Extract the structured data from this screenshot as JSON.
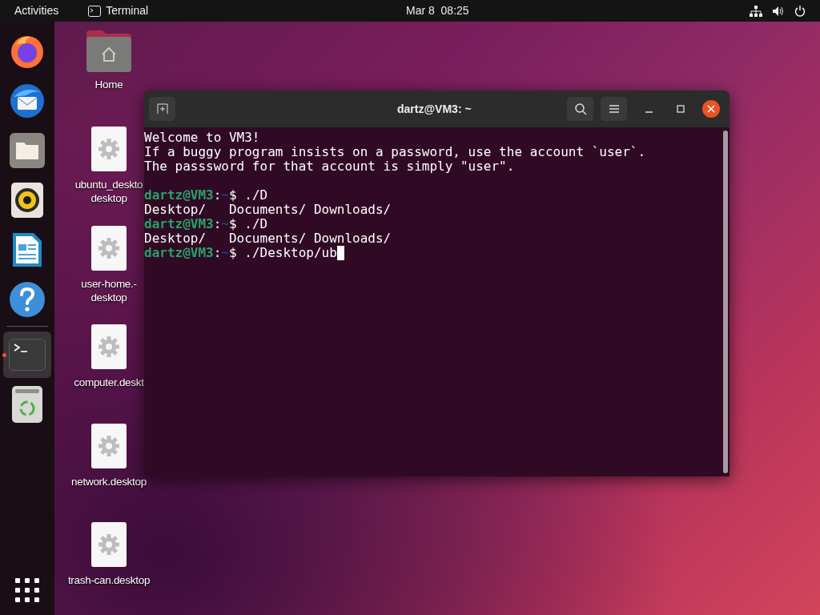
{
  "top_bar": {
    "activities": "Activities",
    "app_name": "Terminal",
    "clock": "Mar 8  08:25"
  },
  "dock": {
    "items": [
      {
        "kind": "firefox",
        "selected": false
      },
      {
        "kind": "thunderbird",
        "selected": false
      },
      {
        "kind": "files",
        "selected": false
      },
      {
        "kind": "rhythmbox",
        "selected": false
      },
      {
        "kind": "writer",
        "selected": false
      },
      {
        "kind": "help",
        "selected": false
      },
      {
        "kind": "terminal",
        "selected": true
      },
      {
        "kind": "trash",
        "selected": false
      }
    ]
  },
  "desktop_icons": [
    {
      "kind": "folder",
      "label_lines": [
        "Home"
      ]
    },
    {
      "kind": "file",
      "label_lines": [
        "ubuntu_deskto",
        "desktop"
      ]
    },
    {
      "kind": "file",
      "label_lines": [
        "user-home.-",
        "desktop"
      ]
    },
    {
      "kind": "file",
      "label_lines": [
        "computer.deskt"
      ]
    },
    {
      "kind": "file",
      "label_lines": [
        "network.desktop"
      ]
    },
    {
      "kind": "file",
      "label_lines": [
        "trash-can.desktop"
      ]
    }
  ],
  "terminal": {
    "title": "dartz@VM3: ~",
    "lines": [
      {
        "kind": "output",
        "text": "Welcome to VM3!"
      },
      {
        "kind": "output",
        "text": "If a buggy program insists on a password, use the account `user`."
      },
      {
        "kind": "output",
        "text": "The passsword for that account is simply \"user\"."
      },
      {
        "kind": "blank"
      },
      {
        "kind": "prompt",
        "user": "dartz@VM3",
        "sep": ":",
        "path": "~",
        "command": "$ ./D",
        "cursor": false
      },
      {
        "kind": "output",
        "text": "Desktop/   Documents/ Downloads/"
      },
      {
        "kind": "prompt",
        "user": "dartz@VM3",
        "sep": ":",
        "path": "~",
        "command": "$ ./D",
        "cursor": false
      },
      {
        "kind": "output",
        "text": "Desktop/   Documents/ Downloads/"
      },
      {
        "kind": "prompt",
        "user": "dartz@VM3",
        "sep": ":",
        "path": "~",
        "command": "$ ./Desktop/ub",
        "cursor": true
      }
    ]
  }
}
